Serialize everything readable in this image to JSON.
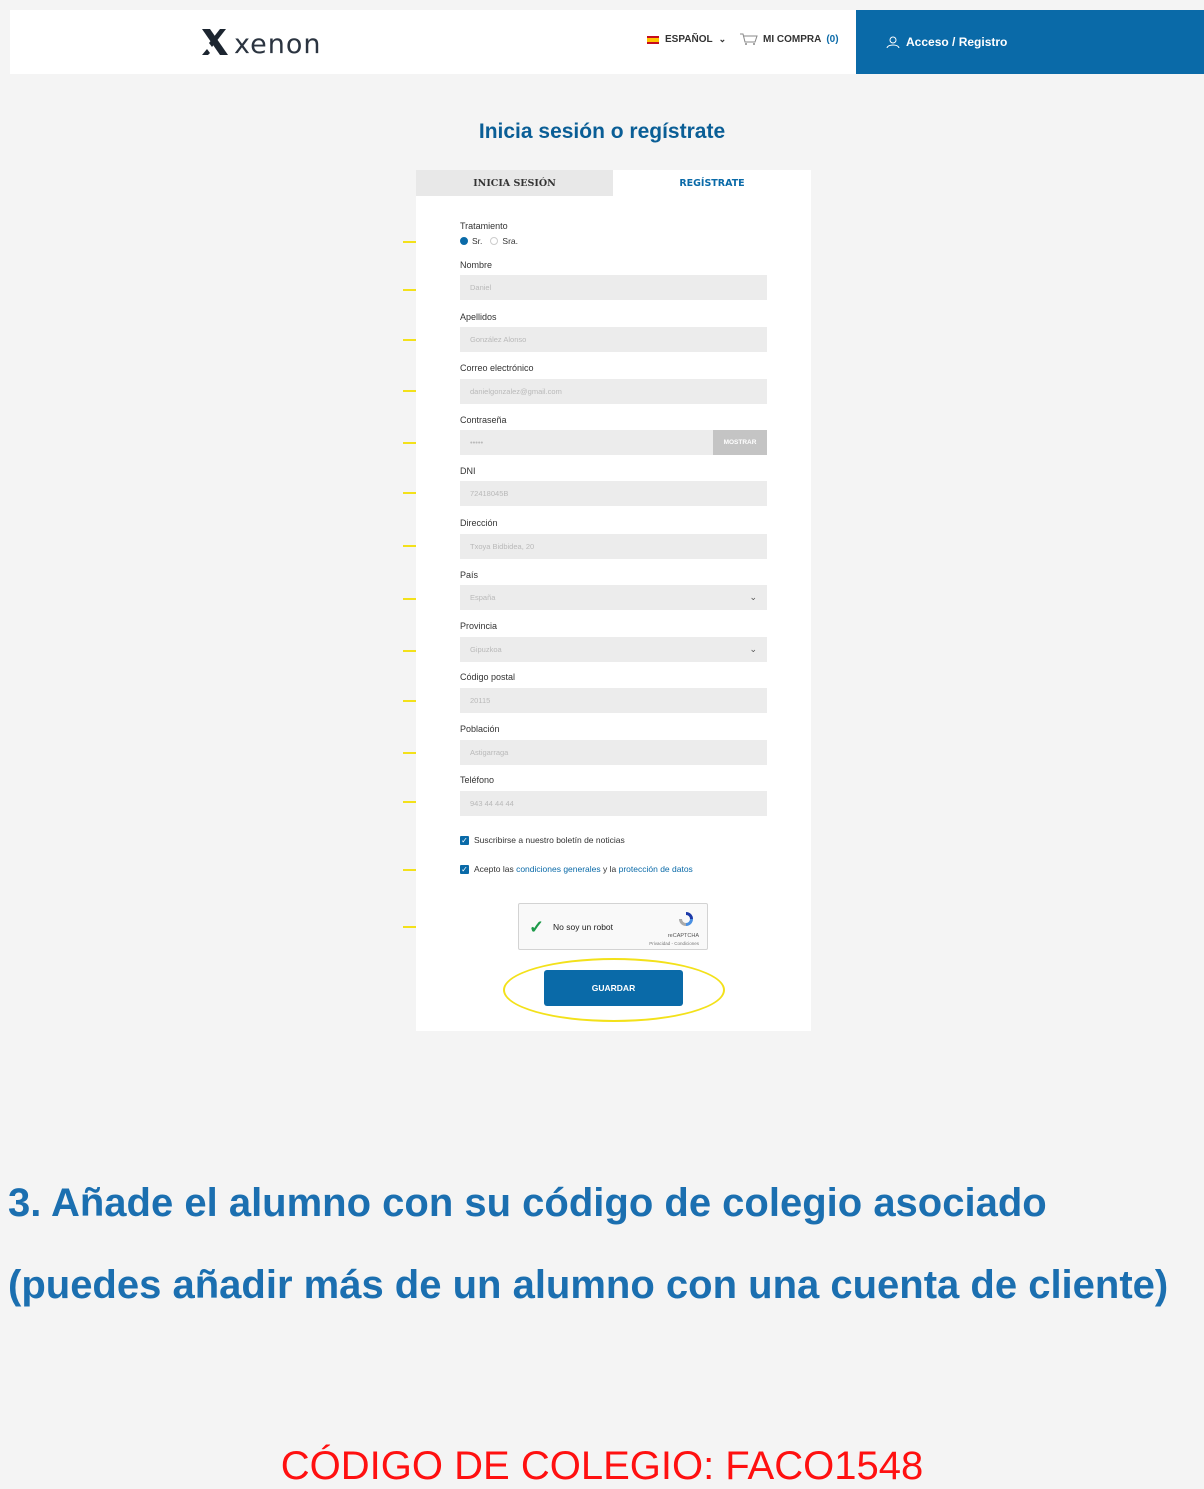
{
  "header": {
    "logo_text": "xenon",
    "language": "ESPAÑOL",
    "cart_label": "MI COMPRA",
    "cart_count": "(0)",
    "account_label": "Acceso / Registro"
  },
  "page_title": "Inicia sesión o regístrate",
  "tabs": {
    "login": "INICIA SESIÓN",
    "register": "REGÍSTRATE"
  },
  "form": {
    "treatment_label": "Tratamiento",
    "radio_sr": "Sr.",
    "radio_sra": "Sra.",
    "selected_treatment": "Sr.",
    "name_label": "Nombre",
    "name_value": "Daniel",
    "surname_label": "Apellidos",
    "surname_value": "González Alonso",
    "email_label": "Correo electrónico",
    "email_value": "danielgonzalez@gmail.com",
    "password_label": "Contraseña",
    "password_value": "•••••",
    "show_button": "MOSTRAR",
    "dni_label": "DNI",
    "dni_value": "72418045B",
    "address_label": "Dirección",
    "address_value": "Txoya Bidbidea, 20",
    "country_label": "País",
    "country_value": "España",
    "province_label": "Provincia",
    "province_value": "Gipuzkoa",
    "postal_label": "Código postal",
    "postal_value": "20115",
    "city_label": "Población",
    "city_value": "Astigarraga",
    "phone_label": "Teléfono",
    "phone_value": "943 44 44 44",
    "newsletter_label": "Suscribirse a nuestro boletín de noticias",
    "accept_prefix": "Acepto las ",
    "accept_link1": "condiciones generales",
    "accept_mid": " y la ",
    "accept_link2": "protección de datos",
    "captcha_label": "No soy un robot",
    "captcha_brand": "reCAPTCHA",
    "captcha_terms": "Privacidad - Condiciones",
    "save_button": "GUARDAR"
  },
  "step_title": "3. Añade el alumno con su código de colegio asociado (puedes añadir más de un alumno con una cuenta de cliente)",
  "code_line": "CÓDIGO DE COLEGIO:   FACO1548",
  "colors": {
    "brand_blue": "#0a6aa8",
    "arrow_yellow": "#f3e11a",
    "code_red": "#ff1010"
  }
}
